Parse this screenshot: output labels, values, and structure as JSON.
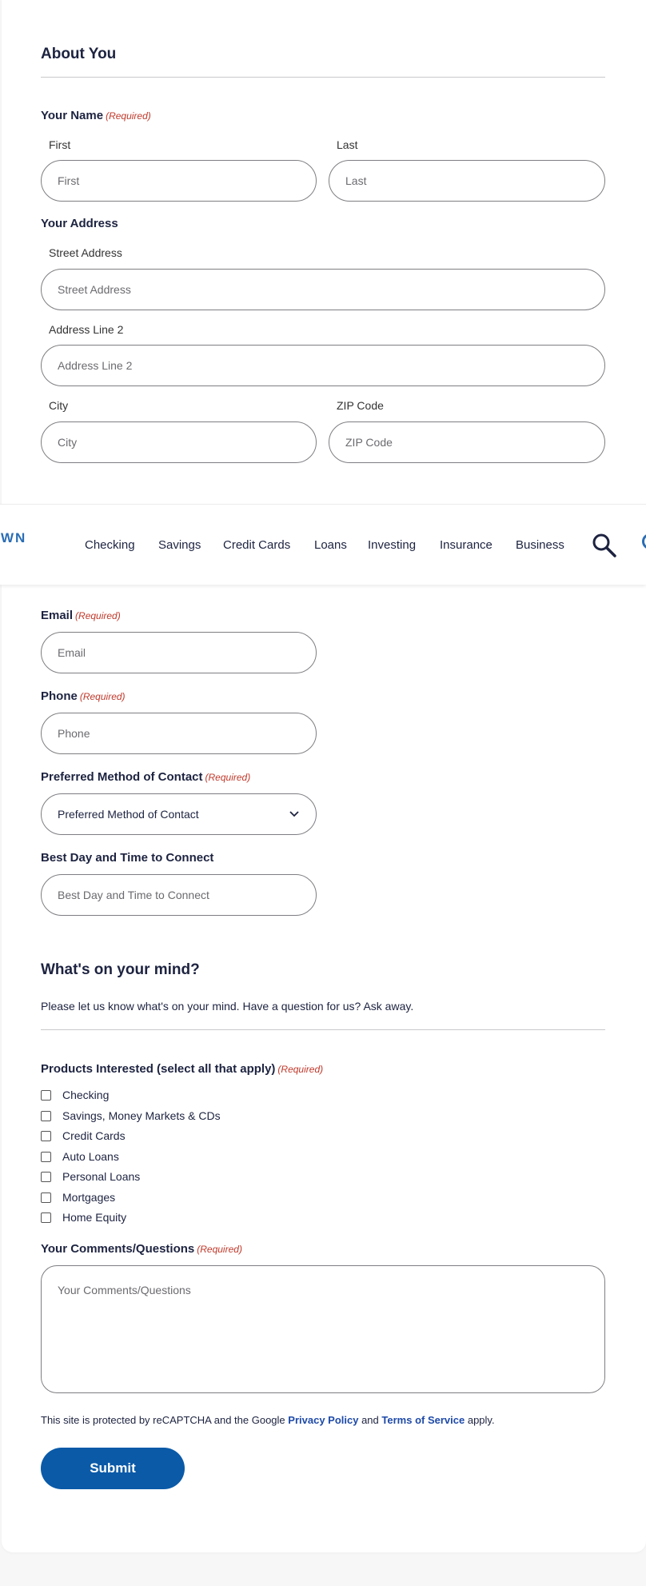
{
  "about": {
    "title": "About You",
    "name_label": "Your Name",
    "required": "(Required)",
    "first_sublabel": "First",
    "first_placeholder": "First",
    "last_sublabel": "Last",
    "last_placeholder": "Last",
    "address_label": "Your Address",
    "street_sublabel": "Street Address",
    "street_placeholder": "Street Address",
    "line2_sublabel": "Address Line 2",
    "line2_placeholder": "Address Line 2",
    "city_sublabel": "City",
    "city_placeholder": "City",
    "zip_sublabel": "ZIP Code",
    "zip_placeholder": "ZIP Code"
  },
  "nav": {
    "logo_fragment": "WN",
    "items": [
      "Checking",
      "Savings",
      "Credit Cards",
      "Loans",
      "Investing",
      "Insurance",
      "Business"
    ]
  },
  "contact": {
    "email_label": "Email",
    "email_placeholder": "Email",
    "phone_label": "Phone",
    "phone_placeholder": "Phone",
    "method_label": "Preferred Method of Contact",
    "method_value": "Preferred Method of Contact",
    "best_time_label": "Best Day and Time to Connect",
    "best_time_placeholder": "Best Day and Time to Connect"
  },
  "mind": {
    "title": "What's on your mind?",
    "intro": "Please let us know what's on your mind. Have a question for us? Ask away.",
    "products_label": "Products Interested (select all that apply)",
    "products": [
      "Checking",
      "Savings, Money Markets & CDs",
      "Credit Cards",
      "Auto Loans",
      "Personal Loans",
      "Mortgages",
      "Home Equity"
    ],
    "comments_label": "Your Comments/Questions",
    "comments_placeholder": "Your Comments/Questions"
  },
  "footer": {
    "recaptcha_prefix": "This site is protected by reCAPTCHA and the Google",
    "privacy_link": "Privacy Policy",
    "and": "and",
    "terms_link": "Terms of Service",
    "suffix": "apply.",
    "submit_label": "Submit"
  },
  "colors": {
    "primary": "#0a5aa8",
    "required": "#c0392b",
    "link": "#1e4aa8",
    "text": "#1d2340"
  }
}
